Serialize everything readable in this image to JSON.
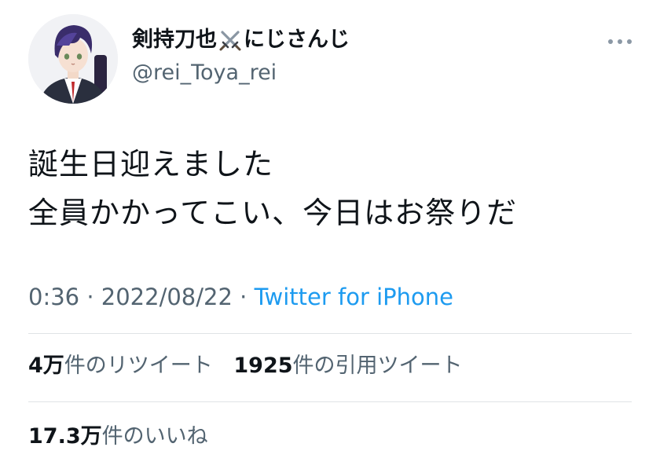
{
  "user": {
    "display_name_prefix": "剣持刀也",
    "display_name_emoji": "crossed-swords-icon",
    "display_name_suffix": "にじさんじ",
    "handle": "@rei_Toya_rei"
  },
  "tweet": {
    "lines": [
      "誕生日迎えました",
      "全員かかってこい、今日はお祭りだ"
    ],
    "time": "0:36",
    "separator": "·",
    "date": "2022/08/22",
    "source": "Twitter for iPhone"
  },
  "stats": {
    "retweets_count": "4万",
    "retweets_label": "件のリツイート",
    "quotes_count": "1925",
    "quotes_label": "件の引用ツイート",
    "likes_count": "17.3万",
    "likes_label": "件のいいね"
  },
  "colors": {
    "text": "#0f1419",
    "secondary": "#536471",
    "link": "#1d9bf0"
  }
}
